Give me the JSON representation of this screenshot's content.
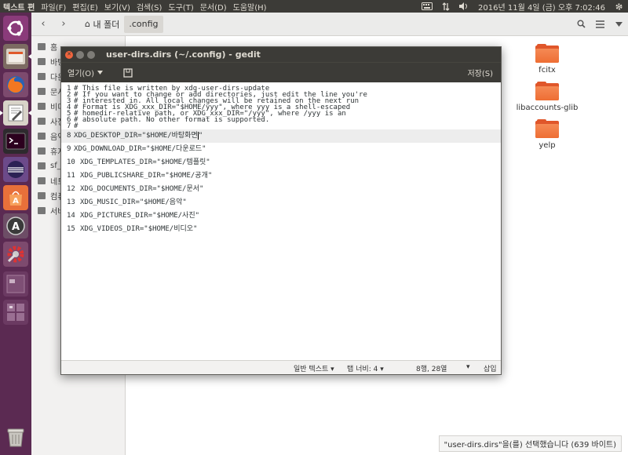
{
  "topbar": {
    "app_name": "텍스트 편",
    "menus": [
      "파일(F)",
      "편집(E)",
      "보기(V)",
      "검색(S)",
      "도구(T)",
      "문서(D)",
      "도움말(H)"
    ],
    "clock": "2016년 11월 4일 (금) 오후 7:02:46"
  },
  "launcher": {
    "icons": [
      "ubuntu-dash-icon",
      "files-icon",
      "firefox-icon",
      "text-editor-icon",
      "terminal-icon",
      "eclipse-icon",
      "software-center-icon",
      "software-updater-icon",
      "system-settings-icon",
      "workspace-icon",
      "workspace-switcher-icon",
      "trash-icon"
    ]
  },
  "filemanager": {
    "breadcrumb_home": "내 폴더",
    "breadcrumb_current": ".config",
    "sidebar": [
      "홈",
      "바탕",
      "다운",
      "문서",
      "비디",
      "사진",
      "음악",
      "휴지",
      "sf_",
      "네트",
      "컴퓨",
      "서버"
    ],
    "folders": [
      "fcitx",
      "libaccounts-glib",
      "yelp"
    ],
    "status": "\"user-dirs.dirs\"을(를) 선택했습니다  (639 바이트)"
  },
  "gedit": {
    "title": "user-dirs.dirs (~/.config) - gedit",
    "open_label": "열기(O)",
    "save_label": "저장(S)",
    "lines": [
      {
        "num": "1",
        "text": "# This file is written by xdg-user-dirs-update"
      },
      {
        "num": "2",
        "text": "# If you want to change or add directories, just edit the line you're"
      },
      {
        "num": "3",
        "text": "# interested in. All local changes will be retained on the next run"
      },
      {
        "num": "4",
        "text": "# Format is XDG_xxx_DIR=\"$HOME/yyy\", where yyy is a shell-escaped"
      },
      {
        "num": "5",
        "text": "# homedir-relative path, or XDG_xxx_DIR=\"/yyy\", where /yyy is an"
      },
      {
        "num": "6",
        "text": "# absolute path. No other format is supported."
      },
      {
        "num": "7",
        "text": "#"
      },
      {
        "num": "8",
        "text_before": "XDG_DESKTOP_DIR=\"$HOME/바탕화면",
        "text_after": "\""
      },
      {
        "num": "9",
        "text": "XDG_DOWNLOAD_DIR=\"$HOME/다운로드\""
      },
      {
        "num": "10",
        "text": "XDG_TEMPLATES_DIR=\"$HOME/템플릿\""
      },
      {
        "num": "11",
        "text": "XDG_PUBLICSHARE_DIR=\"$HOME/공개\""
      },
      {
        "num": "12",
        "text": "XDG_DOCUMENTS_DIR=\"$HOME/문서\""
      },
      {
        "num": "13",
        "text": "XDG_MUSIC_DIR=\"$HOME/음악\""
      },
      {
        "num": "14",
        "text": "XDG_PICTURES_DIR=\"$HOME/사진\""
      },
      {
        "num": "15",
        "text": "XDG_VIDEOS_DIR=\"$HOME/비디오\""
      }
    ],
    "status": {
      "syntax": "일반 텍스트",
      "tab_width": "탭 너비: 4",
      "position": "8행, 28열",
      "mode": "삽입"
    }
  },
  "colors": {
    "launcher_bg": "#5b2a52",
    "panel_bg": "#3c3b37",
    "folder_orange": "#ee6e34",
    "close_button": "#f0643d"
  }
}
